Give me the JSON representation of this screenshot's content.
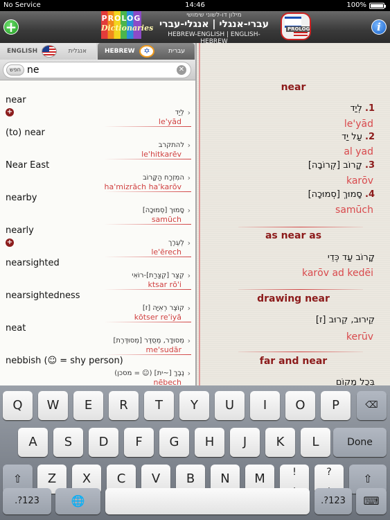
{
  "status_bar": {
    "carrier": "No Service",
    "time": "14:46",
    "battery": "100%"
  },
  "header": {
    "logo_top": "PROLOG",
    "logo_bottom": "Dictionaries",
    "subtitle_hebrew": "מילון דו-לשוני שימושי",
    "title_hebrew": "עברי-אנגלי | אנגלי-עברי",
    "title_english": "HEBREW-ENGLISH | ENGLISH-HEBREW",
    "icon_label": "PROLOG"
  },
  "tabs": {
    "english": {
      "label": "ENGLISH",
      "label_hebrew": "אנגלית"
    },
    "hebrew": {
      "label": "HEBREW",
      "label_hebrew": "עברית"
    }
  },
  "search": {
    "button_label": "חפש",
    "value": "ne",
    "placeholder": ""
  },
  "list": [
    {
      "word": "near",
      "hebrew": "לְיַד",
      "translit": "le'yād",
      "add": true
    },
    {
      "word": "(to) near",
      "hebrew": "להתקרב",
      "translit": "le'hitkarēv",
      "add": false
    },
    {
      "word": "Near East",
      "hebrew": "המִזְרָח הַקָּרוֹב",
      "translit": "ha'mizrāch ha'karōv",
      "add": false
    },
    {
      "word": "nearby",
      "hebrew": "סָמוּך [סְמוּכָה]",
      "translit": "samūch",
      "add": false
    },
    {
      "word": "nearly",
      "hebrew": "לְעֵרֶך",
      "translit": "le'ērech",
      "add": true
    },
    {
      "word": "nearsighted",
      "hebrew": "קְצַר [קְצַרַת]-רוֹאִי",
      "translit": "ktsar rō'i",
      "add": false
    },
    {
      "word": "nearsightedness",
      "hebrew": "קוֹצֶר רְאִיָּה [ז]",
      "translit": "kōtser re'iyā",
      "add": false
    },
    {
      "word": "neat",
      "hebrew": "מְסוּדָר, מְסֻדֶּר [מְסוּדֶּרֶת]",
      "translit": "me'sudār",
      "add": false
    },
    {
      "word": "nebbish (☺ = shy person)",
      "hebrew": "נֶבֶךְ [~ית] (☺ = מסכן)",
      "translit": "nēbech",
      "add": false
    }
  ],
  "detail": {
    "headword": "near",
    "senses": [
      {
        "num": "1.",
        "hebrew": "לְיַד",
        "translit": "le'yād"
      },
      {
        "num": "2.",
        "hebrew": "עַל יַד",
        "translit": "al yad"
      },
      {
        "num": "3.",
        "hebrew": "קָרוֹב [קְרוֹבָה]",
        "translit": "karōv"
      },
      {
        "num": "4.",
        "hebrew": "סָמוּךְ [סְמוּכָה]",
        "translit": "samūch"
      }
    ],
    "phrases": [
      {
        "title": "as near as",
        "hebrew": "קָרוֹב עַד כְּדֵי",
        "translit": "karōv ad kedēi"
      },
      {
        "title": "drawing near",
        "hebrew": "קֵירוּב, קֵרוּב [ז]",
        "translit": "kerūv"
      },
      {
        "title": "far and near",
        "hebrew": "בְּכָל מָקוֹם",
        "translit": ""
      }
    ]
  },
  "keyboard": {
    "row1": [
      "Q",
      "W",
      "E",
      "R",
      "T",
      "Y",
      "U",
      "I",
      "O",
      "P"
    ],
    "row2": [
      "A",
      "S",
      "D",
      "F",
      "G",
      "H",
      "J",
      "K",
      "L"
    ],
    "row3": [
      "Z",
      "X",
      "C",
      "V",
      "B",
      "N",
      "M"
    ],
    "backspace": "⌫",
    "done": "Done",
    "shift": "⇧",
    "exclaim": [
      "!",
      ","
    ],
    "question": [
      "?",
      "."
    ],
    "numbers": ".?123",
    "globe": "🌐",
    "hide": "⌨"
  }
}
